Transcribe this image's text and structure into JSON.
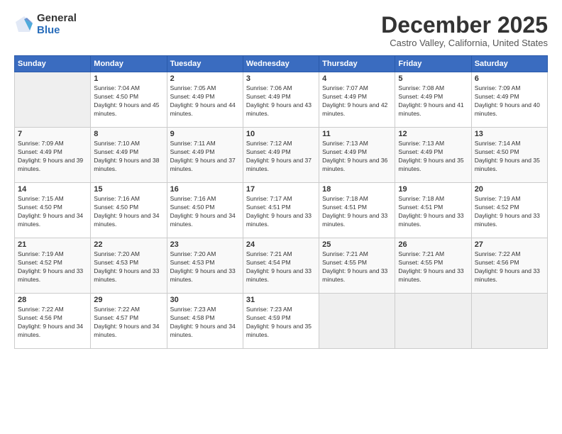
{
  "logo": {
    "general": "General",
    "blue": "Blue"
  },
  "header": {
    "title": "December 2025",
    "subtitle": "Castro Valley, California, United States"
  },
  "weekdays": [
    "Sunday",
    "Monday",
    "Tuesday",
    "Wednesday",
    "Thursday",
    "Friday",
    "Saturday"
  ],
  "weeks": [
    [
      {
        "day": "",
        "sunrise": "",
        "sunset": "",
        "daylight": "",
        "empty": true
      },
      {
        "day": "1",
        "sunrise": "Sunrise: 7:04 AM",
        "sunset": "Sunset: 4:50 PM",
        "daylight": "Daylight: 9 hours and 45 minutes."
      },
      {
        "day": "2",
        "sunrise": "Sunrise: 7:05 AM",
        "sunset": "Sunset: 4:49 PM",
        "daylight": "Daylight: 9 hours and 44 minutes."
      },
      {
        "day": "3",
        "sunrise": "Sunrise: 7:06 AM",
        "sunset": "Sunset: 4:49 PM",
        "daylight": "Daylight: 9 hours and 43 minutes."
      },
      {
        "day": "4",
        "sunrise": "Sunrise: 7:07 AM",
        "sunset": "Sunset: 4:49 PM",
        "daylight": "Daylight: 9 hours and 42 minutes."
      },
      {
        "day": "5",
        "sunrise": "Sunrise: 7:08 AM",
        "sunset": "Sunset: 4:49 PM",
        "daylight": "Daylight: 9 hours and 41 minutes."
      },
      {
        "day": "6",
        "sunrise": "Sunrise: 7:09 AM",
        "sunset": "Sunset: 4:49 PM",
        "daylight": "Daylight: 9 hours and 40 minutes."
      }
    ],
    [
      {
        "day": "7",
        "sunrise": "Sunrise: 7:09 AM",
        "sunset": "Sunset: 4:49 PM",
        "daylight": "Daylight: 9 hours and 39 minutes."
      },
      {
        "day": "8",
        "sunrise": "Sunrise: 7:10 AM",
        "sunset": "Sunset: 4:49 PM",
        "daylight": "Daylight: 9 hours and 38 minutes."
      },
      {
        "day": "9",
        "sunrise": "Sunrise: 7:11 AM",
        "sunset": "Sunset: 4:49 PM",
        "daylight": "Daylight: 9 hours and 37 minutes."
      },
      {
        "day": "10",
        "sunrise": "Sunrise: 7:12 AM",
        "sunset": "Sunset: 4:49 PM",
        "daylight": "Daylight: 9 hours and 37 minutes."
      },
      {
        "day": "11",
        "sunrise": "Sunrise: 7:13 AM",
        "sunset": "Sunset: 4:49 PM",
        "daylight": "Daylight: 9 hours and 36 minutes."
      },
      {
        "day": "12",
        "sunrise": "Sunrise: 7:13 AM",
        "sunset": "Sunset: 4:49 PM",
        "daylight": "Daylight: 9 hours and 35 minutes."
      },
      {
        "day": "13",
        "sunrise": "Sunrise: 7:14 AM",
        "sunset": "Sunset: 4:50 PM",
        "daylight": "Daylight: 9 hours and 35 minutes."
      }
    ],
    [
      {
        "day": "14",
        "sunrise": "Sunrise: 7:15 AM",
        "sunset": "Sunset: 4:50 PM",
        "daylight": "Daylight: 9 hours and 34 minutes."
      },
      {
        "day": "15",
        "sunrise": "Sunrise: 7:16 AM",
        "sunset": "Sunset: 4:50 PM",
        "daylight": "Daylight: 9 hours and 34 minutes."
      },
      {
        "day": "16",
        "sunrise": "Sunrise: 7:16 AM",
        "sunset": "Sunset: 4:50 PM",
        "daylight": "Daylight: 9 hours and 34 minutes."
      },
      {
        "day": "17",
        "sunrise": "Sunrise: 7:17 AM",
        "sunset": "Sunset: 4:51 PM",
        "daylight": "Daylight: 9 hours and 33 minutes."
      },
      {
        "day": "18",
        "sunrise": "Sunrise: 7:18 AM",
        "sunset": "Sunset: 4:51 PM",
        "daylight": "Daylight: 9 hours and 33 minutes."
      },
      {
        "day": "19",
        "sunrise": "Sunrise: 7:18 AM",
        "sunset": "Sunset: 4:51 PM",
        "daylight": "Daylight: 9 hours and 33 minutes."
      },
      {
        "day": "20",
        "sunrise": "Sunrise: 7:19 AM",
        "sunset": "Sunset: 4:52 PM",
        "daylight": "Daylight: 9 hours and 33 minutes."
      }
    ],
    [
      {
        "day": "21",
        "sunrise": "Sunrise: 7:19 AM",
        "sunset": "Sunset: 4:52 PM",
        "daylight": "Daylight: 9 hours and 33 minutes."
      },
      {
        "day": "22",
        "sunrise": "Sunrise: 7:20 AM",
        "sunset": "Sunset: 4:53 PM",
        "daylight": "Daylight: 9 hours and 33 minutes."
      },
      {
        "day": "23",
        "sunrise": "Sunrise: 7:20 AM",
        "sunset": "Sunset: 4:53 PM",
        "daylight": "Daylight: 9 hours and 33 minutes."
      },
      {
        "day": "24",
        "sunrise": "Sunrise: 7:21 AM",
        "sunset": "Sunset: 4:54 PM",
        "daylight": "Daylight: 9 hours and 33 minutes."
      },
      {
        "day": "25",
        "sunrise": "Sunrise: 7:21 AM",
        "sunset": "Sunset: 4:55 PM",
        "daylight": "Daylight: 9 hours and 33 minutes."
      },
      {
        "day": "26",
        "sunrise": "Sunrise: 7:21 AM",
        "sunset": "Sunset: 4:55 PM",
        "daylight": "Daylight: 9 hours and 33 minutes."
      },
      {
        "day": "27",
        "sunrise": "Sunrise: 7:22 AM",
        "sunset": "Sunset: 4:56 PM",
        "daylight": "Daylight: 9 hours and 33 minutes."
      }
    ],
    [
      {
        "day": "28",
        "sunrise": "Sunrise: 7:22 AM",
        "sunset": "Sunset: 4:56 PM",
        "daylight": "Daylight: 9 hours and 34 minutes."
      },
      {
        "day": "29",
        "sunrise": "Sunrise: 7:22 AM",
        "sunset": "Sunset: 4:57 PM",
        "daylight": "Daylight: 9 hours and 34 minutes."
      },
      {
        "day": "30",
        "sunrise": "Sunrise: 7:23 AM",
        "sunset": "Sunset: 4:58 PM",
        "daylight": "Daylight: 9 hours and 34 minutes."
      },
      {
        "day": "31",
        "sunrise": "Sunrise: 7:23 AM",
        "sunset": "Sunset: 4:59 PM",
        "daylight": "Daylight: 9 hours and 35 minutes."
      },
      {
        "day": "",
        "sunrise": "",
        "sunset": "",
        "daylight": "",
        "empty": true
      },
      {
        "day": "",
        "sunrise": "",
        "sunset": "",
        "daylight": "",
        "empty": true
      },
      {
        "day": "",
        "sunrise": "",
        "sunset": "",
        "daylight": "",
        "empty": true
      }
    ]
  ]
}
